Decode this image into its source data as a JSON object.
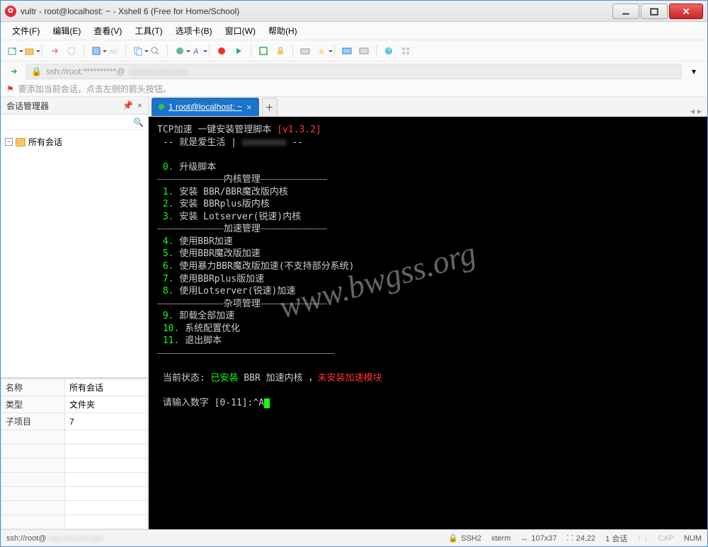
{
  "window": {
    "title": "vultr - root@localhost: ~ - Xshell 6 (Free for Home/School)"
  },
  "menu": [
    "文件(F)",
    "编辑(E)",
    "查看(V)",
    "工具(T)",
    "选项卡(B)",
    "窗口(W)",
    "帮助(H)"
  ],
  "address": {
    "url": "ssh://root:**********@",
    "hidden": "xxx.xxx.xxx.xxx"
  },
  "hint": "要添加当前会话，点击左侧的箭头按钮。",
  "sidebar": {
    "title": "会话管理器",
    "root": "所有会话",
    "props": [
      {
        "k": "名称",
        "v": "所有会话"
      },
      {
        "k": "类型",
        "v": "文件夹"
      },
      {
        "k": "子项目",
        "v": "7"
      }
    ]
  },
  "tab": {
    "num": "1",
    "label": "root@localhost: ~"
  },
  "term": {
    "title": "TCP加速 一键安装管理脚本 ",
    "ver": "[v1.3.2]",
    "sub1": "-- 就是爱生活 | ",
    "sub2_hidden": "xxxxxxxx",
    "sub3": " --",
    "opt0": " 升级脚本",
    "sec1": "内核管理",
    "opt1": " 安装 BBR/BBR魔改版内核",
    "opt2": " 安装 BBRplus版内核",
    "opt3": " 安装 Lotserver(锐速)内核",
    "sec2": "加速管理",
    "opt4": " 使用BBR加速",
    "opt5": " 使用BBR魔改版加速",
    "opt6": " 使用暴力BBR魔改版加速(不支持部分系统)",
    "opt7": " 使用BBRplus版加速",
    "opt8": " 使用Lotserver(锐速)加速",
    "sec3": "杂项管理",
    "opt9": " 卸载全部加速",
    "opt10": " 系统配置优化",
    "opt11": " 退出脚本",
    "status_lbl": " 当前状态: ",
    "status_installed": "已安装",
    "status_mid": " BBR 加速内核 ，",
    "status_not": "未安装加速模块",
    "prompt": " 请输入数字 [0-11]:^A"
  },
  "watermark": "www.bwgss.org",
  "status": {
    "left_prefix": "ssh://root@",
    "left_hidden": "xxx.xxx.xxx.xxx",
    "ssh": "SSH2",
    "term": "xterm",
    "size": "107x37",
    "pos": "24,22",
    "sessions": "1 会话",
    "cap": "CAP",
    "num": "NUM"
  }
}
